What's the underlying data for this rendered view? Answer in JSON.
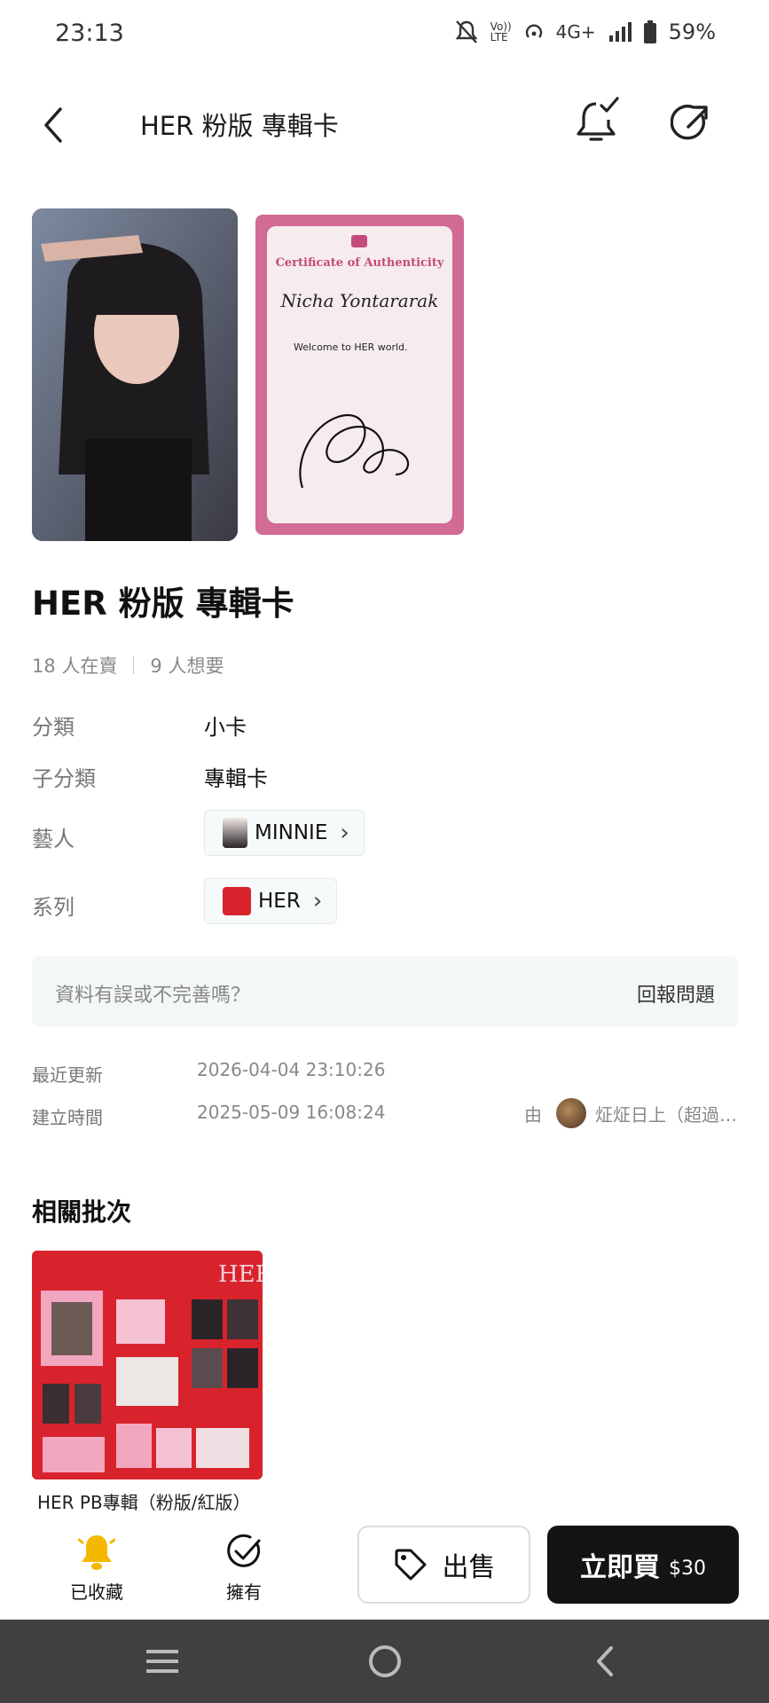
{
  "status_bar": {
    "time": "23:13",
    "network": "4G+",
    "volte": "Vo)) LTE",
    "battery": "59%"
  },
  "header": {
    "title": "HER 粉版 專輯卡",
    "back_icon": "chevron-left-icon",
    "bell_icon": "bell-check-icon",
    "share_icon": "share-icon"
  },
  "cert": {
    "title": "Certificate of Authenticity",
    "name": "Nicha Yontararak",
    "message": "Welcome to HER world."
  },
  "product": {
    "title": "HER 粉版 專輯卡",
    "selling": "18 人在賣",
    "wanting": "9 人想要"
  },
  "attributes": {
    "category_label": "分類",
    "category_value": "小卡",
    "subcategory_label": "子分類",
    "subcategory_value": "專輯卡",
    "artist_label": "藝人",
    "artist_value": "MINNIE",
    "series_label": "系列",
    "series_value": "HER"
  },
  "report": {
    "prompt": "資料有誤或不完善嗎？",
    "link": "回報問題"
  },
  "meta": {
    "updated_label": "最近更新",
    "updated_value": "2026-04-04 23:10:26",
    "created_label": "建立時間",
    "created_value": "2025-05-09 16:08:24",
    "by_prefix": "由",
    "creator_name": "炡炡日上（超過…"
  },
  "related": {
    "title": "相關批次",
    "batch_name": "HER PB專輯（粉版/紅版）"
  },
  "bottom_bar": {
    "favorite_label": "已收藏",
    "own_label": "擁有",
    "sell_label": "出售",
    "buy_label": "立即買",
    "buy_price": "$30"
  },
  "colors": {
    "accent_yellow": "#f5b800",
    "buy_button": "#141414",
    "cert_pink": "#d26b94"
  }
}
